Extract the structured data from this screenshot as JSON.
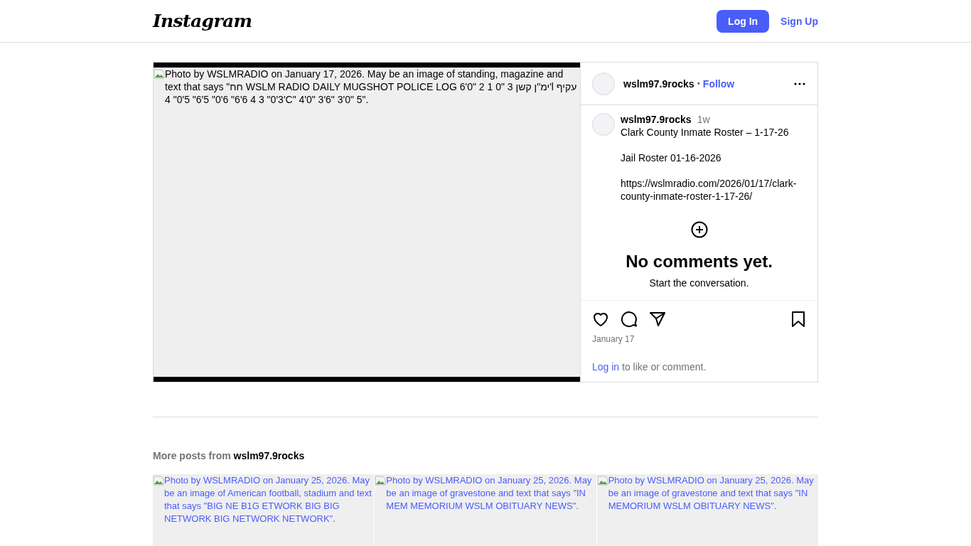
{
  "header": {
    "logo": "Instagram",
    "login_button": "Log In",
    "signup_link": "Sign Up"
  },
  "post": {
    "image_alt": "Photo by WSLMRADIO on January 17, 2026. May be an image of standing, magazine and text that says \"חח WSLM RADIO DAILY MUGSHOT POLICE LOG 6'0\" 2 1 ימ\"ן קשן 3 \"0'l עקיף 3'0\" 3 4 6'6\" 6'0\" 5'6\" 5'0\" 4'C\" 4'0\" 3'6\" 3'0\" 5\".",
    "author": "wslm97.9rocks",
    "separator": "•",
    "follow": "Follow",
    "caption": {
      "author": "wslm97.9rocks",
      "age": "1w",
      "lines": [
        "Clark County Inmate Roster – 1-17-26",
        "Jail Roster 01-16-2026",
        "https://wslmradio.com/2026/01/17/clark-county-inmate-roster-1-17-26/"
      ]
    },
    "no_comments_title": "No comments yet.",
    "no_comments_subtitle": "Start the conversation.",
    "date": "January 17",
    "login_link": "Log in",
    "login_suffix": "to like or comment."
  },
  "more_posts": {
    "label": "More posts from",
    "author": "wslm97.9rocks",
    "items": [
      {
        "alt": "Photo by WSLMRADIO on January 25, 2026. May be an image of American football, stadium and text that says \"BIG NE B1G ETWORK BIG BIG NETWORK BIG NETWORK NETWORK\"."
      },
      {
        "alt": "Photo by WSLMRADIO on January 25, 2026. May be an image of gravestone and text that says \"IN MEM MEMORIUM WSLM OBITUARY NEWS\"."
      },
      {
        "alt": "Photo by WSLMRADIO on January 25, 2026. May be an image of gravestone and text that says \"IN MEMORIUM WSLM OBITUARY NEWS\"."
      }
    ]
  }
}
